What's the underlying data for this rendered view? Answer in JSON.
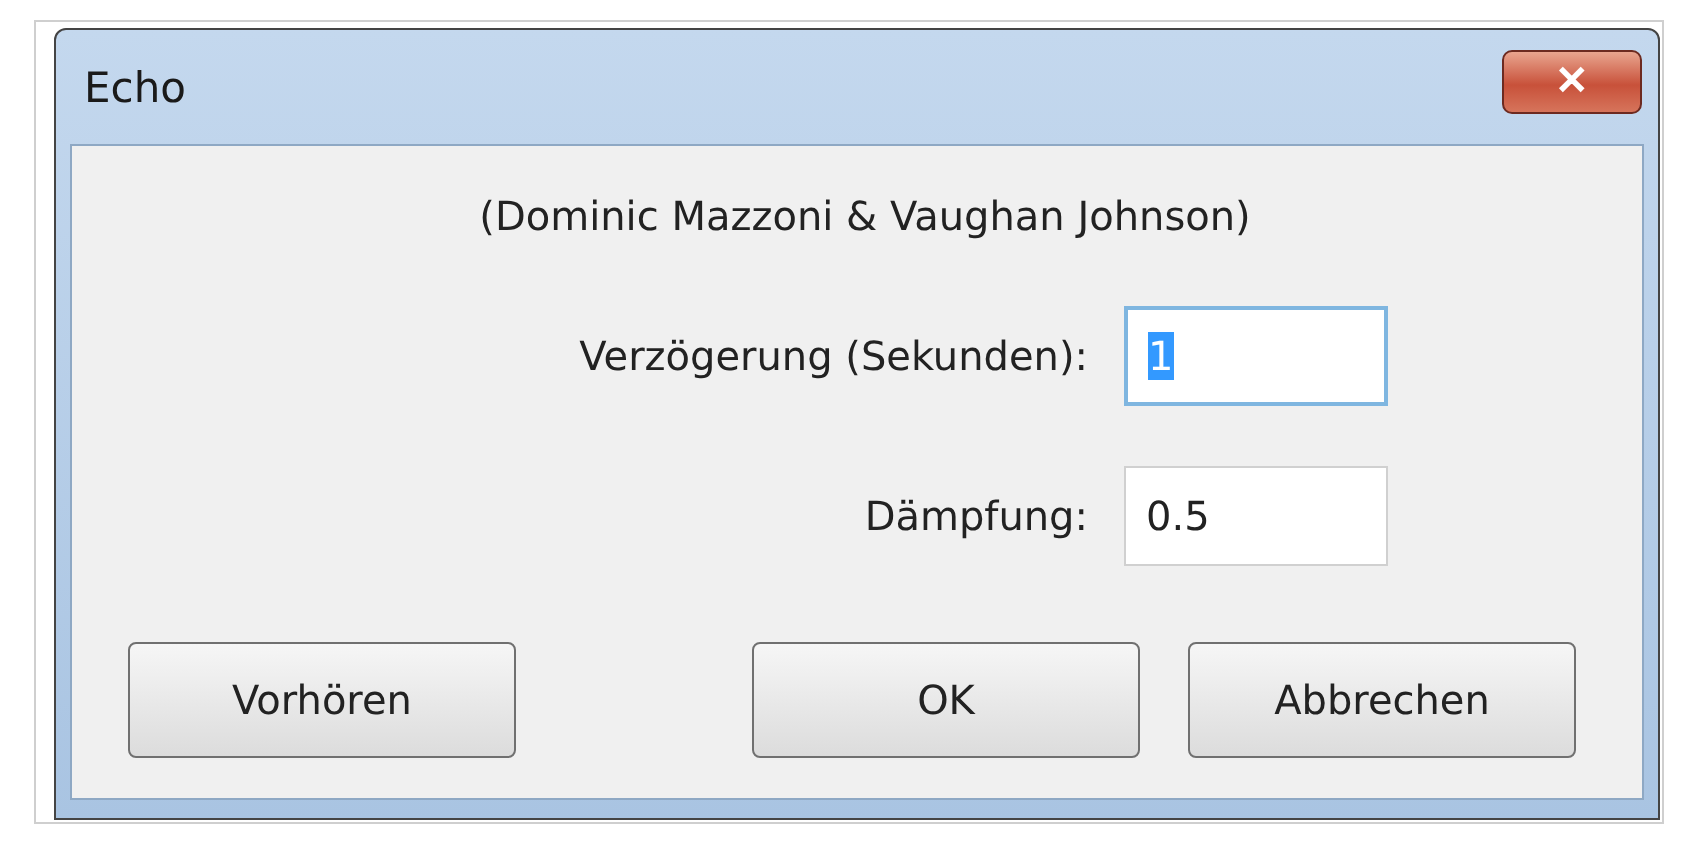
{
  "window": {
    "title": "Echo",
    "close_label": "✕"
  },
  "credit": "(Dominic Mazzoni & Vaughan Johnson)",
  "fields": [
    {
      "label": "Verzögerung (Sekunden):",
      "value": "1",
      "focused": true
    },
    {
      "label": "Dämpfung:",
      "value": "0.5",
      "focused": false
    }
  ],
  "buttons": [
    {
      "label": "Vorhören",
      "kind": "left"
    },
    {
      "label": "OK",
      "kind": "right"
    },
    {
      "label": "Abbrechen",
      "kind": "right"
    }
  ]
}
